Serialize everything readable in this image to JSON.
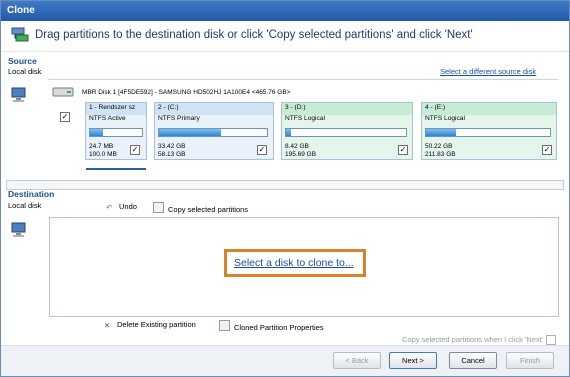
{
  "window": {
    "title": "Clone"
  },
  "header": {
    "instruction": "Drag partitions to the destination disk or click 'Copy selected partitions' and click 'Next'"
  },
  "source": {
    "label": "Source",
    "disk_label": "Local disk",
    "select_link": "Select a different source disk",
    "disk_info": "MBR Disk 1 [4F5DE592] - SAMSUNG HD502HJ 1A100E4  <465.76 GB>",
    "partitions": [
      {
        "name": "1 - Rendszer sz",
        "type": "NTFS Active",
        "used": "24.7 MB",
        "total": "100.0 MB",
        "fill": 0.25,
        "checked": true
      },
      {
        "name": "2 - (C:)",
        "type": "NTFS Primary",
        "used": "33.42 GB",
        "total": "58.13 GB",
        "fill": 0.57,
        "checked": true
      },
      {
        "name": "3 - (D:)",
        "type": "NTFS Logical",
        "used": "8.42 GB",
        "total": "195.69 GB",
        "fill": 0.04,
        "checked": true
      },
      {
        "name": "4 - (E:)",
        "type": "NTFS Logical",
        "used": "50.22 GB",
        "total": "211.83 GB",
        "fill": 0.24,
        "checked": true
      }
    ]
  },
  "destination": {
    "label": "Destination",
    "disk_label": "Local disk",
    "undo": "Undo",
    "copy_selected": "Copy selected partitions",
    "select_link": "Select a disk to clone to...",
    "delete_existing": "Delete Existing partition",
    "cloned_props": "Cloned Partition Properties",
    "copy_when_next": "Copy selected partitions when I click 'Next'"
  },
  "buttons": {
    "back": "< Back",
    "next": "Next >",
    "cancel": "Cancel",
    "finish": "Finish"
  },
  "colors": {
    "accent": "#1a4fa0",
    "highlight": "#d7822e",
    "partition_blue": "#cfe3f5",
    "partition_green": "#cfeedd"
  }
}
